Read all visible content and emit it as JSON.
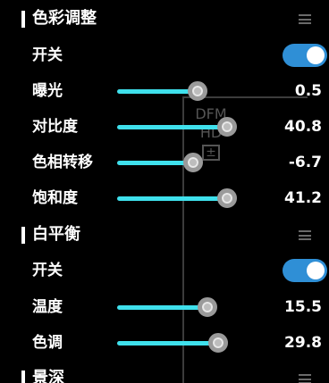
{
  "sections": [
    {
      "title": "色彩调整",
      "switch_label": "开关",
      "switch_on": true,
      "sliders": [
        {
          "label": "曝光",
          "value": "0.5",
          "level": 0.72
        },
        {
          "label": "对比度",
          "value": "40.8",
          "level": 0.98
        },
        {
          "label": "色相转移",
          "value": "-6.7",
          "level": 0.68
        },
        {
          "label": "饱和度",
          "value": "41.2",
          "level": 0.98
        }
      ]
    },
    {
      "title": "白平衡",
      "switch_label": "开关",
      "switch_on": true,
      "sliders": [
        {
          "label": "温度",
          "value": "15.5",
          "level": 0.81
        },
        {
          "label": "色调",
          "value": "29.8",
          "level": 0.9
        }
      ]
    },
    {
      "title": "景深"
    }
  ],
  "overlay_badges": [
    "DFM",
    "HD"
  ],
  "icons": {
    "drag": "drag-handle-icon",
    "overlay": "exposure-compensation-icon"
  },
  "colors": {
    "accent": "#3fe0ec",
    "toggle_on": "#2f8fd6",
    "background": "#000000"
  }
}
